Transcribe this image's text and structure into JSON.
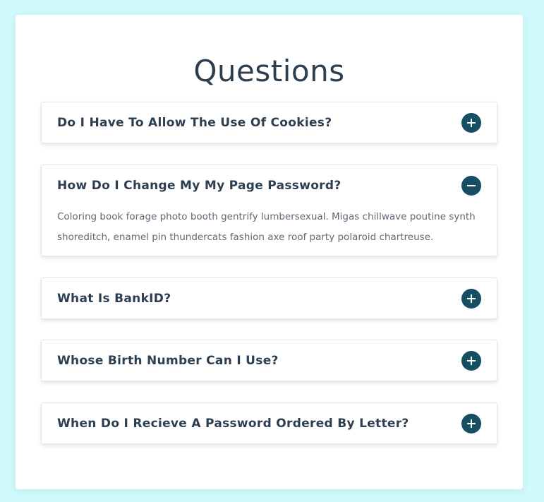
{
  "page": {
    "title": "Questions"
  },
  "faq": [
    {
      "question": "Do I Have To Allow The Use Of Cookies?",
      "expanded": false,
      "toggle_icon": "plus-icon"
    },
    {
      "question": "How Do I Change My My Page Password?",
      "expanded": true,
      "toggle_icon": "minus-icon",
      "answer": "Coloring book forage photo booth gentrify lumbersexual. Migas chillwave poutine synth shoreditch, enamel pin thundercats fashion axe roof party polaroid chartreuse."
    },
    {
      "question": "What Is BankID?",
      "expanded": false,
      "toggle_icon": "plus-icon"
    },
    {
      "question": "Whose Birth Number Can I Use?",
      "expanded": false,
      "toggle_icon": "plus-icon"
    },
    {
      "question": "When Do I Recieve A Password Ordered By Letter?",
      "expanded": false,
      "toggle_icon": "plus-icon"
    }
  ],
  "colors": {
    "background": "#cff9fc",
    "card": "#ffffff",
    "heading": "#2c3e50",
    "toggle": "#164f64",
    "answer_text": "#5e6a76"
  }
}
